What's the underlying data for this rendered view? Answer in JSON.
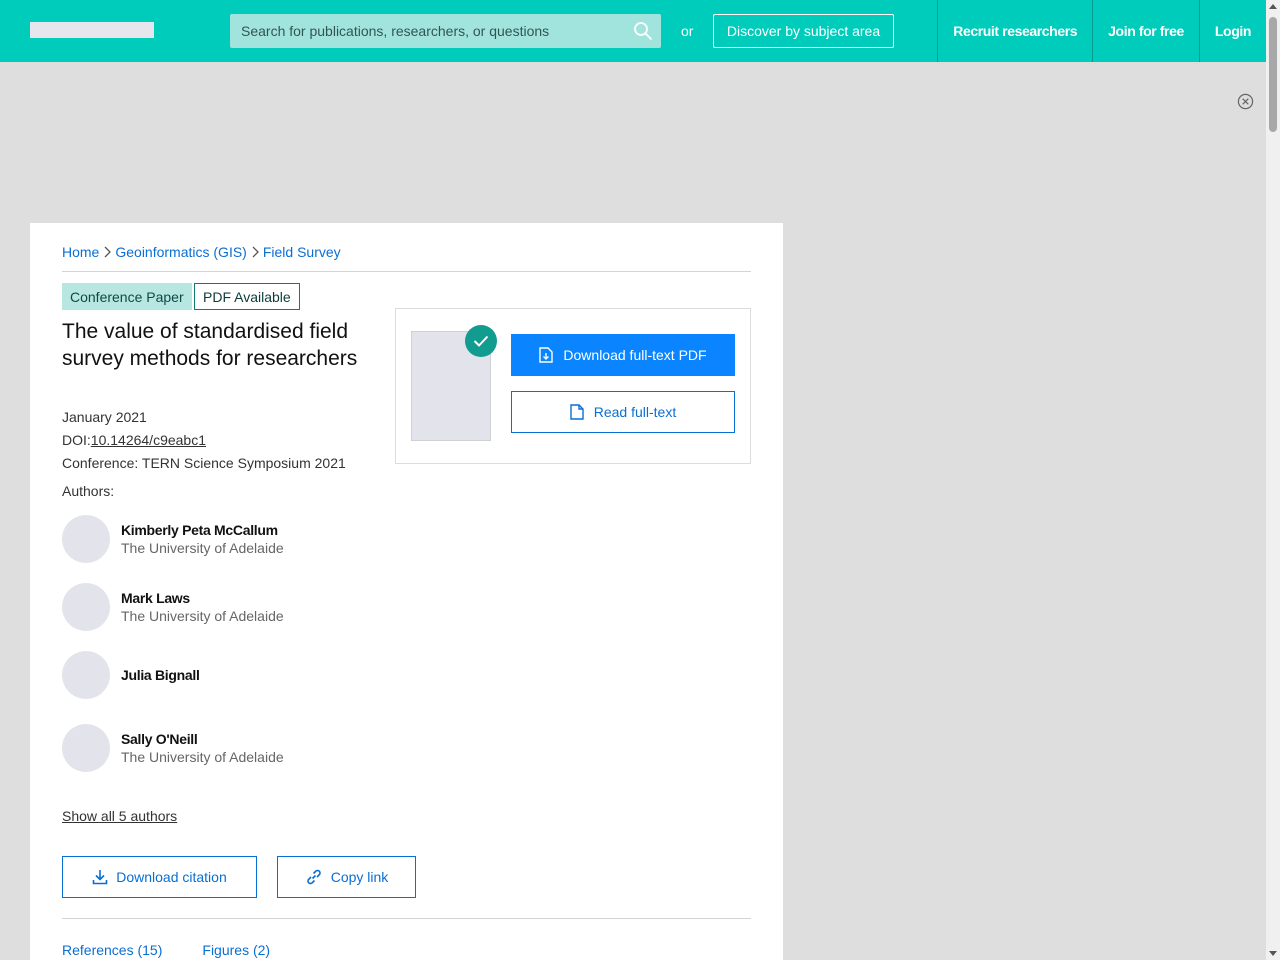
{
  "header": {
    "search_placeholder": "Search for publications, researchers, or questions",
    "or_text": "or",
    "discover_label": "Discover by subject area",
    "nav": [
      "Recruit researchers",
      "Join for free",
      "Login"
    ]
  },
  "breadcrumb": [
    "Home",
    "Geoinformatics (GIS)",
    "Field Survey"
  ],
  "tags": {
    "type": "Conference Paper",
    "availability": "PDF Available"
  },
  "paper": {
    "title": "The value of standardised field survey methods for researchers",
    "date": "January 2021",
    "doi_label": "DOI:",
    "doi": "10.14264/c9eabc1",
    "conference": "Conference: TERN Science Symposium 2021",
    "authors_label": "Authors:"
  },
  "authors": [
    {
      "name": "Kimberly Peta McCallum",
      "affiliation": "The University of Adelaide"
    },
    {
      "name": "Mark Laws",
      "affiliation": "The University of Adelaide"
    },
    {
      "name": "Julia Bignall",
      "affiliation": ""
    },
    {
      "name": "Sally O'Neill",
      "affiliation": "The University of Adelaide"
    }
  ],
  "show_all_authors": "Show all 5 authors",
  "actions": {
    "download_pdf": "Download full-text PDF",
    "read_fulltext": "Read full-text",
    "download_citation": "Download citation",
    "copy_link": "Copy link"
  },
  "tabs": [
    "References (15)",
    "Figures (2)"
  ],
  "colors": {
    "brand": "#00ccbb",
    "link": "#0a6fd3",
    "primary_button": "#0a85ff",
    "check": "#119c8f"
  },
  "icons": [
    "search-icon",
    "close-circle-icon",
    "chevron-right-icon",
    "check-icon",
    "file-download-icon",
    "file-icon",
    "download-icon",
    "link-icon"
  ]
}
